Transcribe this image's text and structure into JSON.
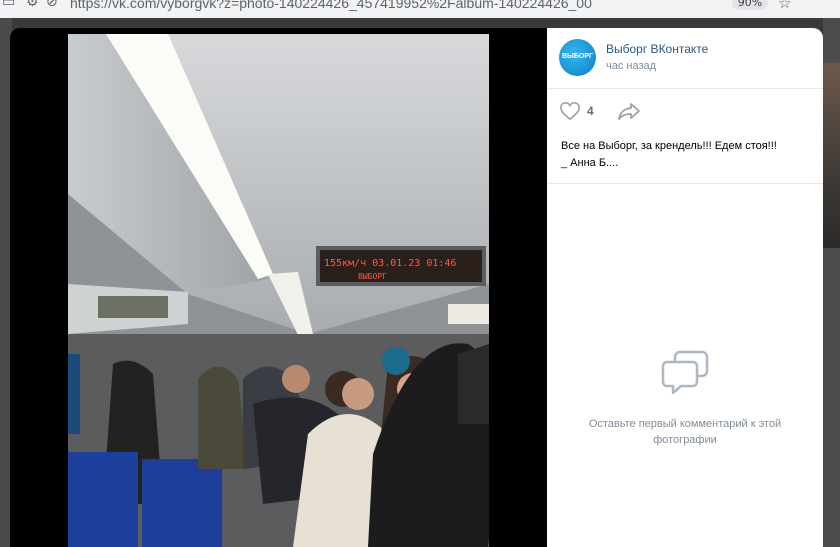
{
  "browser": {
    "url": "https://vk.com/vyborgvk?z=photo-140224426_457419952%2Falbum-140224426_00",
    "zoom": "90%"
  },
  "post": {
    "author": "Выборг ВКонтакте",
    "avatar_text": "ВЫБОРГ",
    "time": "час назад",
    "like_count": "4",
    "caption_line1": "Все на Выборг, за крендель!!! Едем стоя!!!",
    "caption_line2": "_ Анна Б...."
  },
  "photo": {
    "board_text": "155км/ч  03.01.23  01:46",
    "board_text2": "ВЫБОРГ"
  },
  "comments": {
    "empty_text": "Оставьте первый комментарий к этой фотографии"
  },
  "colors": {
    "link": "#2a5885",
    "muted": "#818c99",
    "icon": "#99a2ad"
  }
}
